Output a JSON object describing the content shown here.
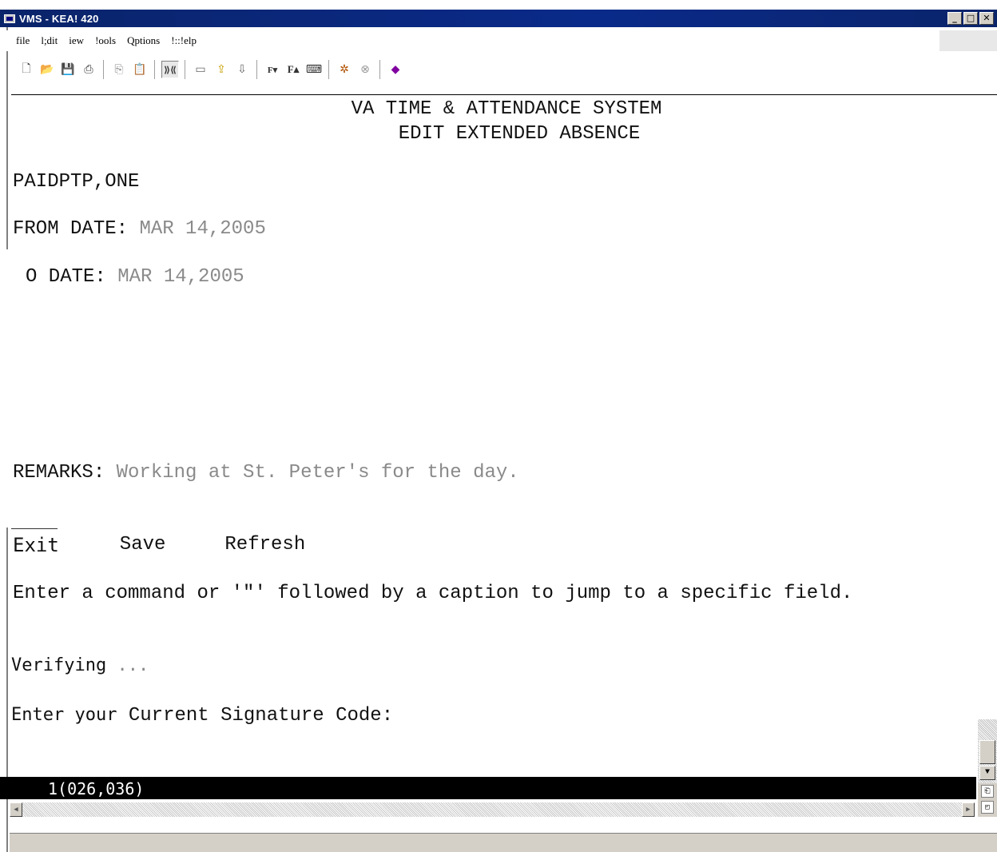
{
  "window": {
    "title": "VMS - KEA! 420",
    "buttons": [
      "_",
      "□",
      "✕"
    ]
  },
  "menu": {
    "items": [
      "file",
      "l;dit",
      "iew",
      "!ools",
      "Qptions",
      "!::!elp"
    ]
  },
  "toolbar": {
    "icons": [
      "new-icon",
      "open-icon",
      "save-icon",
      "print-icon",
      "copy-icon",
      "paste-icon",
      "connect-icon",
      "send-icon",
      "receive-icon",
      "transfer-icon",
      "font-down-icon",
      "font-up-icon",
      "keyboard-icon",
      "macro-icon",
      "stop-icon",
      "help-book-icon"
    ]
  },
  "screen": {
    "header_line1": "VA TIME & ATTENDANCE SYSTEM",
    "header_line2": "EDIT EXTENDED ABSENCE",
    "employee_name": "PAIDPTP,ONE",
    "from_date_label": "FROM DATE:",
    "from_date_value": "MAR 14,2005",
    "to_date_label": "O DATE:",
    "to_date_value": "MAR 14,2005",
    "remarks_label": "REMARKS:",
    "remarks_value": "Working at St. Peter's for the day.",
    "commands": [
      "Exit",
      "Save",
      "Refresh"
    ],
    "prompt_help": "Enter a command or '\"' followed by a caption to jump to a specific field.",
    "verifying_label": "Verifying",
    "verifying_dots": "...",
    "signature_prefix": "Enter your",
    "signature_prompt": "Current Signature Code:"
  },
  "status": {
    "cursor_position": "1(026,036)"
  }
}
